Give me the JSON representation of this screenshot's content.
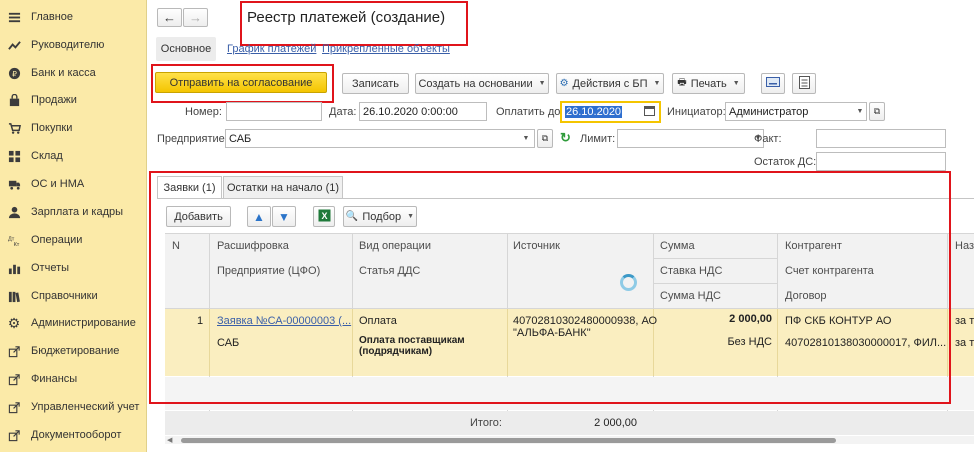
{
  "sidebar": {
    "items": [
      {
        "label": "Главное",
        "icon": "list-icon"
      },
      {
        "label": "Руководителю",
        "icon": "chart-trend-icon"
      },
      {
        "label": "Банк и касса",
        "icon": "coin-icon"
      },
      {
        "label": "Продажи",
        "icon": "bag-icon"
      },
      {
        "label": "Покупки",
        "icon": "cart-icon"
      },
      {
        "label": "Склад",
        "icon": "grid-icon"
      },
      {
        "label": "ОС и НМА",
        "icon": "truck-icon"
      },
      {
        "label": "Зарплата и кадры",
        "icon": "person-icon"
      },
      {
        "label": "Операции",
        "icon": "dt-kt-icon"
      },
      {
        "label": "Отчеты",
        "icon": "bar-chart-icon"
      },
      {
        "label": "Справочники",
        "icon": "books-icon"
      },
      {
        "label": "Администрирование",
        "icon": "gear-icon"
      },
      {
        "label": "Бюджетирование",
        "icon": "link-icon"
      },
      {
        "label": "Финансы",
        "icon": "link-icon"
      },
      {
        "label": "Управленческий учет",
        "icon": "link-icon"
      },
      {
        "label": "Документооборот",
        "icon": "link-icon"
      }
    ]
  },
  "header": {
    "title": "Реестр платежей (создание)",
    "tabs": [
      "Основное",
      "График платежей",
      "Прикрепленные объекты"
    ]
  },
  "toolbar": {
    "send_label": "Отправить на согласование",
    "save_label": "Записать",
    "create_based_label": "Создать на основании",
    "actions_label": "Действия с БП",
    "print_label": "Печать"
  },
  "form": {
    "number_label": "Номер:",
    "number_value": "",
    "date_label": "Дата:",
    "date_value": "26.10.2020  0:00:00",
    "pay_until_label": "Оплатить до:",
    "pay_until_value": "26.10.2020",
    "initiator_label": "Инициатор:",
    "initiator_value": "Администратор",
    "enterprise_label": "Предприятие:",
    "enterprise_value": "САБ",
    "limit_label": "Лимит:",
    "limit_value": "",
    "fact_label": "Факт:",
    "fact_value": "",
    "balance_label": "Остаток ДС:",
    "balance_value": ""
  },
  "inner_tabs": [
    "Заявки (1)",
    "Остатки на начало (1)"
  ],
  "table_toolbar": {
    "add_label": "Добавить",
    "select_label": "Подбор"
  },
  "table": {
    "headers": {
      "n": "N",
      "decoding": "Расшифровка",
      "enterprise_cfo": "Предприятие (ЦФО)",
      "op_type": "Вид операции",
      "dds_item": "Статья ДДС",
      "source": "Источник",
      "amount": "Сумма",
      "vat_rate": "Ставка НДС",
      "vat_amount": "Сумма НДС",
      "counterparty": "Контрагент",
      "cp_account": "Счет контрагента",
      "contract": "Договор",
      "purpose": "Наз"
    },
    "rows": [
      {
        "n": "1",
        "decoding": "Заявка №СА-00000003 (...",
        "enterprise": "САБ",
        "op_type": "Оплата",
        "dds_item_line1": "Оплата поставщикам",
        "dds_item_line2": "(подрядчикам)",
        "source_line1": "40702810302480000938, АО",
        "source_line2": "\"АЛЬФА-БАНК\"",
        "amount": "2 000,00",
        "vat_rate": "Без НДС",
        "counterparty": "ПФ СКБ КОНТУР АО",
        "cp_account": "40702810138030000017, ФИЛ...",
        "purpose_line1": "за т",
        "purpose_line2": "за т"
      }
    ],
    "total_label": "Итого:",
    "total_value": "2 000,00"
  },
  "colors": {
    "sidebar_bg": "#fbeaa8",
    "accent_yellow": "#f4c500",
    "highlight_red": "#e0141b",
    "row_selected": "#faeec0"
  }
}
